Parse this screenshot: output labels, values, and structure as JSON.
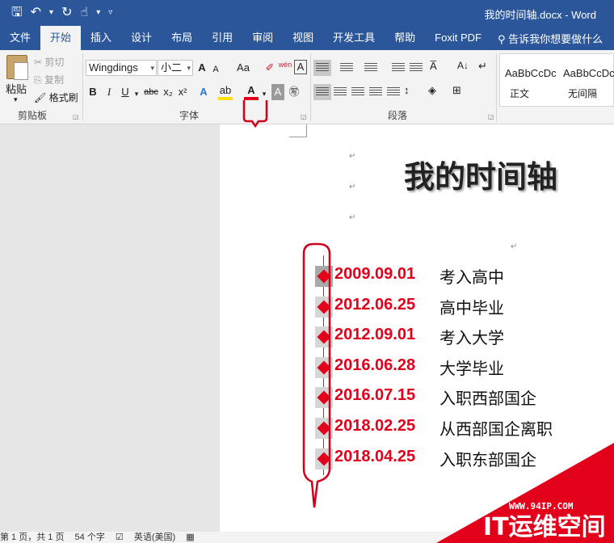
{
  "window": {
    "title": "我的时间轴.docx - Word",
    "qat": {
      "save_icon": "save-icon",
      "undo_icon": "undo-icon",
      "redo_icon": "redo-icon",
      "touch_icon": "touch-mode-icon"
    }
  },
  "ribbon_tabs": [
    "文件",
    "开始",
    "插入",
    "设计",
    "布局",
    "引用",
    "审阅",
    "视图",
    "开发工具",
    "帮助",
    "Foxit PDF"
  ],
  "active_tab": "开始",
  "tell_me": "告诉我你想要做什么",
  "clipboard": {
    "paste": "粘贴",
    "cut": "剪切",
    "copy": "复制",
    "format_painter": "格式刷",
    "label": "剪贴板"
  },
  "font": {
    "name": "Wingdings",
    "size": "小二",
    "grow": "A",
    "shrink": "A",
    "case": "Aa",
    "phonetic": "wén",
    "bold": "B",
    "italic": "I",
    "underline": "U",
    "strike": "abc",
    "subscript": "x₂",
    "superscript": "x²",
    "font_color": "A",
    "label": "字体"
  },
  "paragraph": {
    "label": "段落"
  },
  "styles": [
    {
      "sample": "AaBbCcDc",
      "name": "正文"
    },
    {
      "sample": "AaBbCcDc",
      "name": "无间隔"
    }
  ],
  "document": {
    "title": "我的时间轴",
    "timeline": [
      {
        "date": "2009.09.01",
        "event": "考入高中"
      },
      {
        "date": "2012.06.25",
        "event": "高中毕业"
      },
      {
        "date": "2012.09.01",
        "event": "考入大学"
      },
      {
        "date": "2016.06.28",
        "event": "大学毕业"
      },
      {
        "date": "2016.07.15",
        "event": "入职西部国企"
      },
      {
        "date": "2018.02.25",
        "event": "从西部国企离职"
      },
      {
        "date": "2018.04.25",
        "event": "入职东部国企"
      }
    ]
  },
  "status": {
    "page": "第 1 页，共 1 页",
    "words": "54 个字",
    "language": "英语(美国)"
  },
  "watermark": {
    "url": "WWW.94IP.COM",
    "name": "IT运维空间"
  },
  "colors": {
    "accent": "#2b579a",
    "timeline_red": "#e3001b",
    "annotation_red": "#d0021b"
  }
}
